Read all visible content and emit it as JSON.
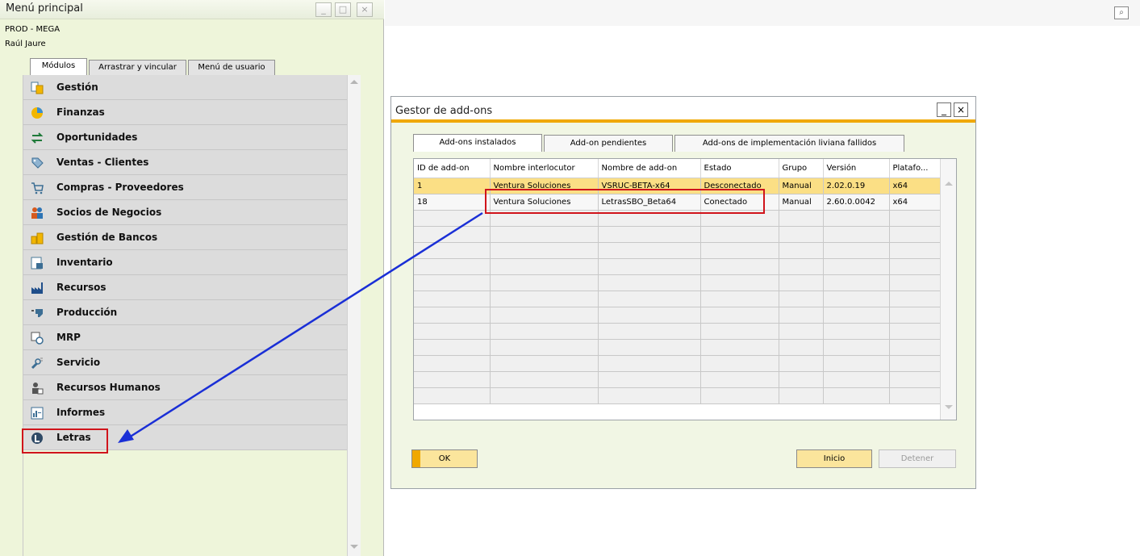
{
  "main_menu": {
    "title": "Menú principal",
    "db": "PROD - MEGA",
    "user": "Raúl Jaure",
    "window_buttons": [
      "_",
      "□",
      "×"
    ],
    "tabs": [
      "Módulos",
      "Arrastrar y vincular",
      "Menú de usuario"
    ],
    "modules": [
      {
        "label": "Gestión",
        "icon": "gestion-icon"
      },
      {
        "label": "Finanzas",
        "icon": "finanzas-icon"
      },
      {
        "label": "Oportunidades",
        "icon": "oportunidades-icon"
      },
      {
        "label": "Ventas - Clientes",
        "icon": "ventas-icon"
      },
      {
        "label": "Compras - Proveedores",
        "icon": "cart-icon"
      },
      {
        "label": "Socios de Negocios",
        "icon": "people-icon"
      },
      {
        "label": "Gestión de Bancos",
        "icon": "bank-icon"
      },
      {
        "label": "Inventario",
        "icon": "inventory-icon"
      },
      {
        "label": "Recursos",
        "icon": "factory-icon"
      },
      {
        "label": "Producción",
        "icon": "production-icon"
      },
      {
        "label": "MRP",
        "icon": "mrp-icon"
      },
      {
        "label": "Servicio",
        "icon": "wrench-icon"
      },
      {
        "label": "Recursos Humanos",
        "icon": "hr-icon"
      },
      {
        "label": "Informes",
        "icon": "report-icon"
      },
      {
        "label": "Letras",
        "icon": "letras-icon"
      }
    ]
  },
  "addon_manager": {
    "title": "Gestor de add-ons",
    "min_btn": "_",
    "close_btn": "×",
    "tabs": [
      "Add-ons instalados",
      "Add-on pendientes",
      "Add-ons de implementación liviana fallidos"
    ],
    "columns": [
      "ID de add-on",
      "Nombre interlocutor",
      "Nombre de add-on",
      "Estado",
      "Grupo",
      "Versión",
      "Platafo..."
    ],
    "rows": [
      [
        "1",
        "Ventura Soluciones",
        "VSRUC-BETA-x64",
        "Desconectado",
        "Manual",
        "2.02.0.19",
        "x64"
      ],
      [
        "18",
        "Ventura Soluciones",
        "LetrasSBO_Beta64",
        "Conectado",
        "Manual",
        "2.60.0.0042",
        "x64"
      ]
    ],
    "ok_label": "OK",
    "start_label": "Inicio",
    "stop_label": "Detener"
  },
  "colors": {
    "accent": "#f0a800",
    "highlight": "#d0141b",
    "arrow": "#1a2fd6",
    "selected_row": "#fbdf85"
  }
}
